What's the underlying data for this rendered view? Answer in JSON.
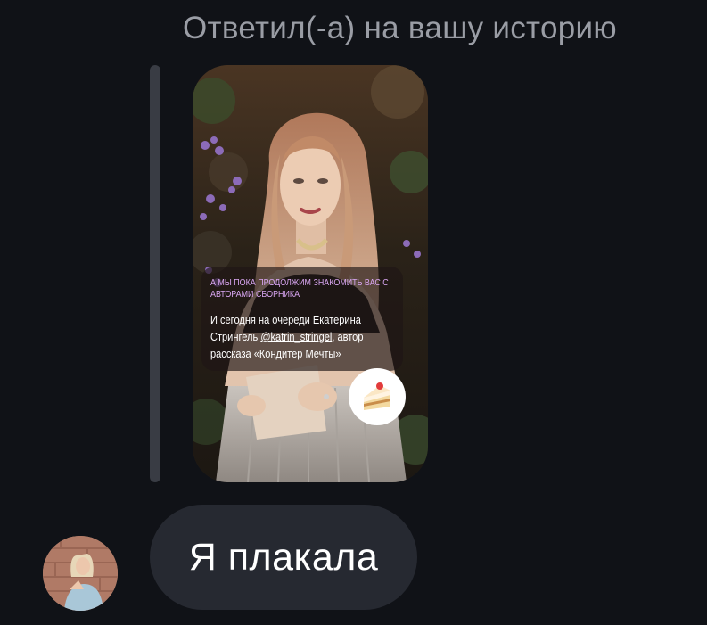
{
  "reply": {
    "header": "Ответил(-а) на вашу историю"
  },
  "story": {
    "photo_icon": "story-photo-icon",
    "caption_headline": "А МЫ ПОКА ПРОДОЛЖИМ ЗНАКОМИТЬ ВАС С АВТОРАМИ СБОРНИКА",
    "caption_body_before": "И сегодня на очереди Екатерина Стрингель ",
    "caption_mention": "@katrin_stringel",
    "caption_body_after": ", автор рассказа «Кондитер Мечты»",
    "sticker_icon": "cake-icon",
    "headline_color": "#d9a6f2"
  },
  "message": {
    "avatar_icon": "user-avatar",
    "text": "Я плакала",
    "bubble_color": "#262931"
  },
  "theme": {
    "background": "#101217",
    "muted_text": "#9a9da5",
    "reply_line": "#393c44"
  }
}
